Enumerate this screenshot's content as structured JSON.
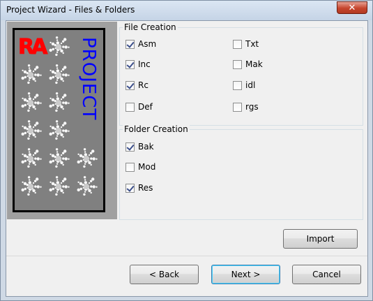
{
  "window": {
    "title": "Project Wizard - Files & Folders",
    "close_glyph": "✕"
  },
  "logo": {
    "mark": "RA",
    "vertical_text": "PROJECT",
    "mark_color": "#ff0000",
    "text_color": "#0000ff"
  },
  "file_creation": {
    "label": "File Creation",
    "items": [
      {
        "label": "Asm",
        "checked": true
      },
      {
        "label": "Inc",
        "checked": true
      },
      {
        "label": "Rc",
        "checked": true
      },
      {
        "label": "Def",
        "checked": false
      },
      {
        "label": "Txt",
        "checked": false
      },
      {
        "label": "Mak",
        "checked": false
      },
      {
        "label": "idl",
        "checked": false
      },
      {
        "label": "rgs",
        "checked": false
      }
    ]
  },
  "folder_creation": {
    "label": "Folder Creation",
    "items": [
      {
        "label": "Bak",
        "checked": true
      },
      {
        "label": "Mod",
        "checked": false
      },
      {
        "label": "Res",
        "checked": true
      }
    ]
  },
  "buttons": {
    "import": "Import",
    "back": "< Back",
    "next": "Next >",
    "cancel": "Cancel"
  }
}
